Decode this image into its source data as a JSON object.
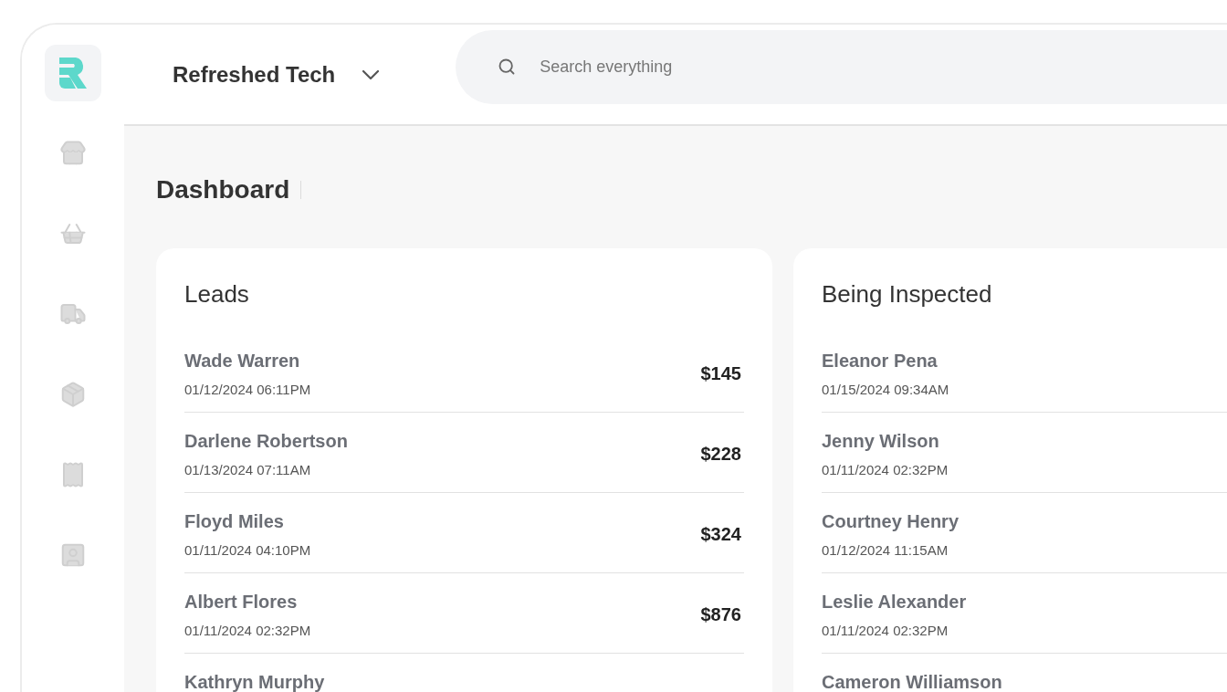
{
  "header": {
    "workspace": "Refreshed Tech",
    "search": {
      "placeholder": "Search everything"
    }
  },
  "page_title": "Dashboard",
  "boards": [
    {
      "title": "Leads",
      "rows": [
        {
          "name": "Wade Warren",
          "date": "01/12/2024 06:11PM",
          "amount": "$145"
        },
        {
          "name": "Darlene Robertson",
          "date": "01/13/2024 07:11AM",
          "amount": "$228"
        },
        {
          "name": "Floyd Miles",
          "date": "01/11/2024 04:10PM",
          "amount": "$324"
        },
        {
          "name": "Albert Flores",
          "date": "01/11/2024 02:32PM",
          "amount": "$876"
        },
        {
          "name": "Kathryn Murphy"
        }
      ]
    },
    {
      "title": "Being Inspected",
      "rows": [
        {
          "name": "Eleanor Pena",
          "date": "01/15/2024 09:34AM"
        },
        {
          "name": "Jenny Wilson",
          "date": "01/11/2024 02:32PM"
        },
        {
          "name": "Courtney Henry",
          "date": "01/12/2024 11:15AM"
        },
        {
          "name": "Leslie Alexander",
          "date": "01/11/2024 02:32PM"
        },
        {
          "name": "Cameron Williamson"
        }
      ]
    }
  ]
}
